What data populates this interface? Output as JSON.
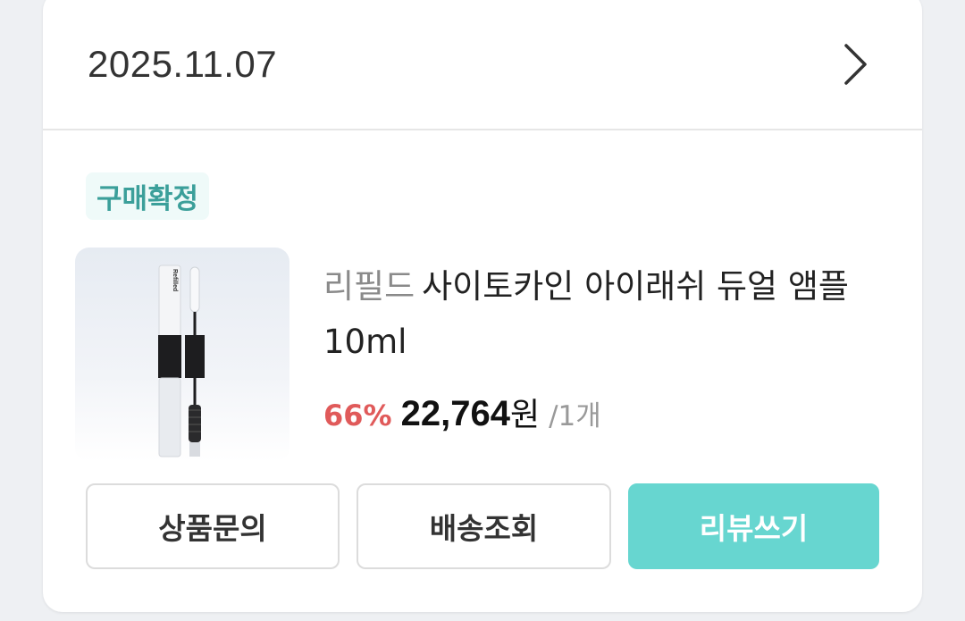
{
  "order": {
    "date": "2025.11.07",
    "status_badge": "구매확정"
  },
  "product": {
    "brand": "리필드",
    "name": "사이토카인 아이래쉬 듀얼 앰플 10ml",
    "image_text": "Refilled",
    "discount": "66%",
    "price": "22,764",
    "currency": "원",
    "quantity": "/1개"
  },
  "actions": {
    "inquiry_label": "상품문의",
    "tracking_label": "배송조회",
    "review_label": "리뷰쓰기"
  },
  "colors": {
    "accent": "#67d6d0",
    "badge_bg": "#effaf9",
    "badge_text": "#3b9f9a",
    "discount": "#e05a5a"
  }
}
